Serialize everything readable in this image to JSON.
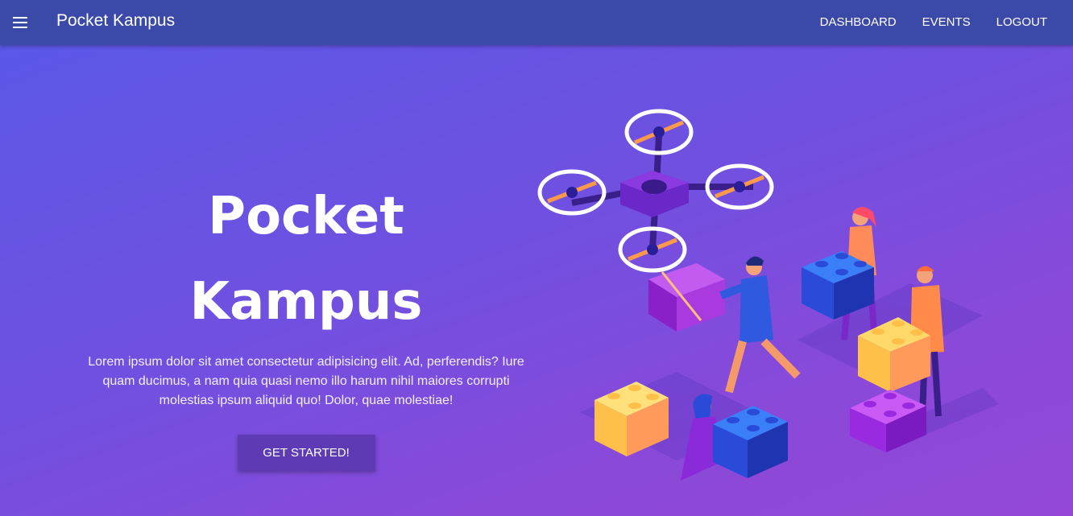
{
  "navbar": {
    "brand": "Pocket Kampus",
    "links": [
      "DASHBOARD",
      "EVENTS",
      "LOGOUT"
    ]
  },
  "hero": {
    "title_line1": "Pocket",
    "title_line2": "Kampus",
    "description": "Lorem ipsum dolor sit amet consectetur adipisicing elit. Ad, perferendis? Iure quam ducimus, a nam quia quasi nemo illo harum nihil maiores corrupti molestias ipsum aliquid quo! Dolor, quae molestiae!",
    "cta_label": "GET STARTED!"
  },
  "colors": {
    "navbar": "#3b4aa8",
    "gradient_start": "#5b57e6",
    "gradient_end": "#9447d6",
    "cta": "#5e3bb5"
  },
  "icons": [
    "hamburger-menu-icon"
  ],
  "illustration": "isometric-drone-and-people-with-blocks"
}
